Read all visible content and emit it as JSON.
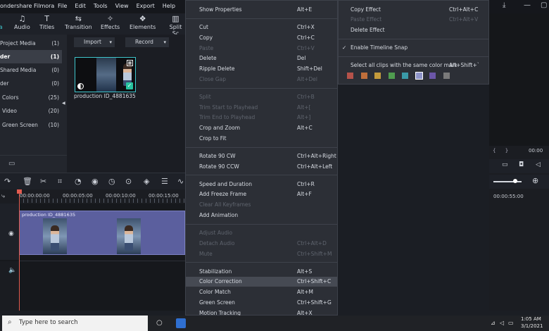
{
  "titlebar": {
    "app_title": "ondershare Filmora",
    "menu": [
      "File",
      "Edit",
      "Tools",
      "View",
      "Export",
      "Help"
    ]
  },
  "tabs": [
    {
      "label": "a",
      "icon": "media-icon"
    },
    {
      "label": "Audio",
      "icon": "music-note-icon"
    },
    {
      "label": "Titles",
      "icon": "text-icon"
    },
    {
      "label": "Transition",
      "icon": "transition-icon"
    },
    {
      "label": "Effects",
      "icon": "effects-icon"
    },
    {
      "label": "Elements",
      "icon": "elements-icon"
    },
    {
      "label": "Split Sc",
      "icon": "split-screen-icon"
    }
  ],
  "library": {
    "items": [
      {
        "label": "Project Media",
        "count": "(1)"
      },
      {
        "label": "der",
        "count": "(1)",
        "selected": true
      },
      {
        "label": "Shared Media",
        "count": "(0)"
      },
      {
        "label": "der",
        "count": "(0)"
      },
      {
        "label": "Colors",
        "count": "(25)"
      },
      {
        "label": "Video",
        "count": "(20)"
      },
      {
        "label": "Green Screen",
        "count": "(10)"
      }
    ]
  },
  "media": {
    "import_label": "Import",
    "record_label": "Record",
    "clip_name": "production ID_4881635"
  },
  "timeline": {
    "ruler": [
      "00:00:00:00",
      "00:00:05:00",
      "00:00:10:00",
      "00:00:15:00"
    ],
    "clip_title": "production ID_4881635",
    "right_timecode": "00:00:55:00",
    "right_timecode_top": "00:00"
  },
  "context_menu": {
    "items": [
      {
        "label": "Show Properties",
        "shortcut": "Alt+E",
        "disabled": false
      },
      {
        "sep": true
      },
      {
        "label": "Cut",
        "shortcut": "Ctrl+X",
        "disabled": false
      },
      {
        "label": "Copy",
        "shortcut": "Ctrl+C",
        "disabled": false
      },
      {
        "label": "Paste",
        "shortcut": "Ctrl+V",
        "disabled": true
      },
      {
        "label": "Delete",
        "shortcut": "Del",
        "disabled": false
      },
      {
        "label": "Ripple Delete",
        "shortcut": "Shift+Del",
        "disabled": false
      },
      {
        "label": "Close Gap",
        "shortcut": "Alt+Del",
        "disabled": true
      },
      {
        "sep": true
      },
      {
        "label": "Split",
        "shortcut": "Ctrl+B",
        "disabled": true
      },
      {
        "label": "Trim Start to Playhead",
        "shortcut": "Alt+[",
        "disabled": true
      },
      {
        "label": "Trim End to Playhead",
        "shortcut": "Alt+]",
        "disabled": true
      },
      {
        "label": "Crop and Zoom",
        "shortcut": "Alt+C",
        "disabled": false
      },
      {
        "label": "Crop to Fit",
        "shortcut": "",
        "disabled": false
      },
      {
        "sep": true
      },
      {
        "label": "Rotate 90 CW",
        "shortcut": "Ctrl+Alt+Right",
        "disabled": false
      },
      {
        "label": "Rotate 90 CCW",
        "shortcut": "Ctrl+Alt+Left",
        "disabled": false
      },
      {
        "sep": true
      },
      {
        "label": "Speed and Duration",
        "shortcut": "Ctrl+R",
        "disabled": false
      },
      {
        "label": "Add Freeze Frame",
        "shortcut": "Alt+F",
        "disabled": false
      },
      {
        "label": "Clear All Keyframes",
        "shortcut": "",
        "disabled": true
      },
      {
        "label": "Add Animation",
        "shortcut": "",
        "disabled": false
      },
      {
        "sep": true
      },
      {
        "label": "Adjust Audio",
        "shortcut": "",
        "disabled": true
      },
      {
        "label": "Detach Audio",
        "shortcut": "Ctrl+Alt+D",
        "disabled": true
      },
      {
        "label": "Mute",
        "shortcut": "Ctrl+Shift+M",
        "disabled": true
      },
      {
        "sep": true
      },
      {
        "label": "Stabilization",
        "shortcut": "Alt+S",
        "disabled": false
      },
      {
        "label": "Color Correction",
        "shortcut": "Ctrl+Shift+C",
        "disabled": false,
        "highlighted": true
      },
      {
        "label": "Color Match",
        "shortcut": "Alt+M",
        "disabled": false
      },
      {
        "label": "Green Screen",
        "shortcut": "Ctrl+Shift+G",
        "disabled": false
      },
      {
        "label": "Motion Tracking",
        "shortcut": "Alt+X",
        "disabled": false
      }
    ]
  },
  "context_menu2": {
    "copy_effect": {
      "label": "Copy Effect",
      "shortcut": "Ctrl+Alt+C"
    },
    "paste_effect": {
      "label": "Paste Effect",
      "shortcut": "Ctrl+Alt+V"
    },
    "delete_effect": {
      "label": "Delete Effect"
    },
    "snap": {
      "label": "Enable Timeline Snap",
      "check": "✓"
    },
    "color_mark": {
      "label": "Select all clips with the same color mark",
      "shortcut": "Alt+Shift+`"
    },
    "swatches": [
      "#b5524a",
      "#c06f3b",
      "#c49b3c",
      "#4f9c4f",
      "#3a9aa8",
      "#8e94c8",
      "#6b56a8",
      "#7a7a7a"
    ]
  },
  "taskbar": {
    "search_placeholder": "Type here to search",
    "time": "1:05 AM",
    "date": "3/1/2021"
  }
}
